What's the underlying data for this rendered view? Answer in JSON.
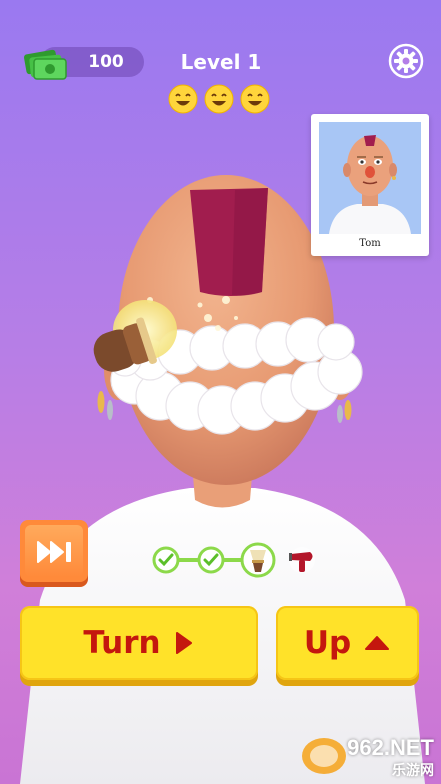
{
  "hud": {
    "cash": "100",
    "level": "Level 1",
    "ratings": [
      "smile-emoji",
      "smile-emoji",
      "smile-emoji"
    ]
  },
  "reference": {
    "name": "Tom"
  },
  "progress": {
    "steps": [
      {
        "icon": "check-icon",
        "state": "done"
      },
      {
        "icon": "check-icon",
        "state": "done"
      },
      {
        "icon": "shaving-brush-icon",
        "state": "current"
      },
      {
        "icon": "hair-dryer-icon",
        "state": "upcoming"
      }
    ]
  },
  "buttons": {
    "turn": "Turn",
    "up": "Up"
  },
  "watermark": {
    "top": "962.NET",
    "bottom": "乐游网"
  },
  "colors": {
    "button_yellow": "#ffe229",
    "button_text": "#c4170e",
    "skip_orange": "#ff8a3a",
    "progress_green": "#8cd94a"
  }
}
